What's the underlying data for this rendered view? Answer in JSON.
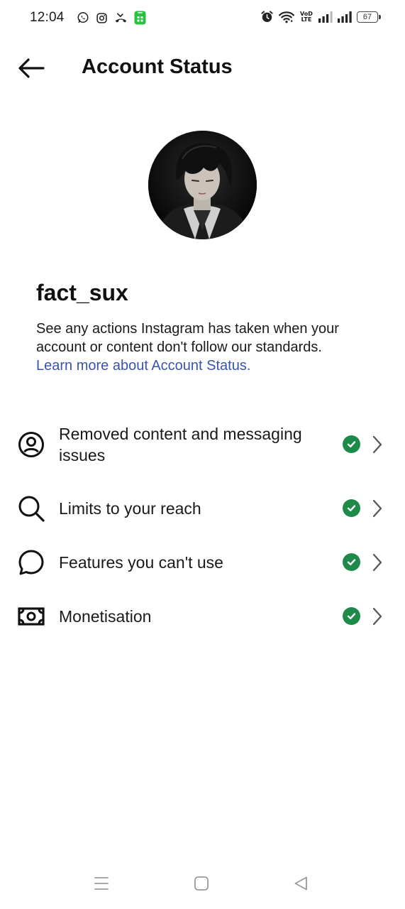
{
  "status_bar": {
    "time": "12:04",
    "left_icons": [
      "whatsapp-icon",
      "instagram-icon",
      "missed-call-icon",
      "app-notification-icon"
    ],
    "right_icons": [
      "alarm-icon",
      "wifi-icon",
      "volte-icon",
      "signal-icon",
      "signal-icon",
      "battery-icon"
    ],
    "volte_line1": "VoD",
    "volte_line2": "LTE",
    "battery_level": "67"
  },
  "header": {
    "back_icon": "arrow-left-icon",
    "title": "Account Status"
  },
  "profile": {
    "username": "fact_sux",
    "description": "See any actions Instagram has taken when your account or content don't follow our standards.",
    "learn_more": "Learn more about Account Status."
  },
  "status_items": [
    {
      "label": "Removed content and messaging issues",
      "icon": "user-circle-icon",
      "status": "ok"
    },
    {
      "label": "Limits to your reach",
      "icon": "search-icon",
      "status": "ok"
    },
    {
      "label": "Features you can't use",
      "icon": "chat-bubble-icon",
      "status": "ok"
    },
    {
      "label": "Monetisation",
      "icon": "banknote-icon",
      "status": "ok"
    }
  ],
  "colors": {
    "accent_link": "#3a52b0",
    "status_ok": "#1e8a4a",
    "text": "#111111",
    "background": "#ffffff"
  },
  "system_nav": {
    "icons": [
      "menu-icon",
      "home-square-icon",
      "back-triangle-icon"
    ]
  }
}
